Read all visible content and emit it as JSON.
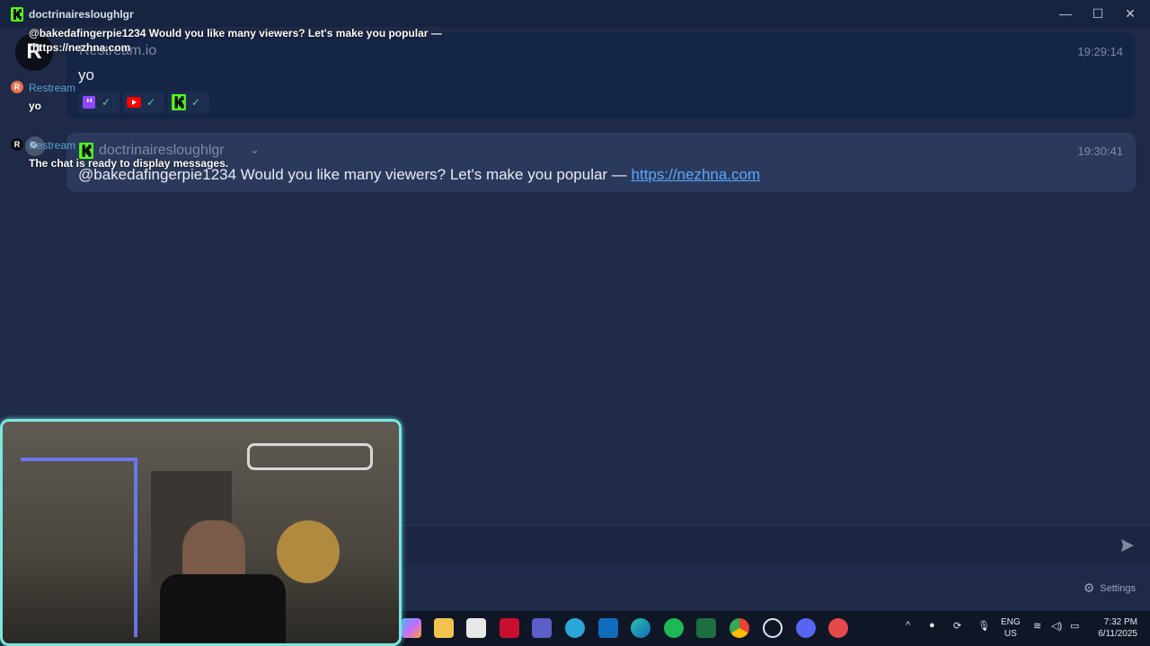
{
  "window": {
    "title": "doctrinairesloughlgr",
    "minimize": "—",
    "maximize": "☐",
    "close": "✕"
  },
  "overlay": {
    "top_line": "@bakedafingerpie1234 Would you like many viewers? Let's make you popular —",
    "top_link": "https://nezhna.com",
    "restream_label": "Restream",
    "restream_msg": "yo",
    "restream_label2": "Restream",
    "ready_text": "The chat is ready to display messages."
  },
  "messages": [
    {
      "sender": "Restream.io",
      "time": "19:29:14",
      "text": "yo",
      "platforms": [
        "twitch",
        "youtube",
        "kick"
      ]
    },
    {
      "sender": "doctrinairesloughlgr",
      "time": "19:30:41",
      "text": "@bakedafingerpie1234 Would you like many viewers? Let's make you popular — ",
      "link": "https://nezhna.com"
    }
  ],
  "settings": {
    "label": "Settings"
  },
  "taskbar": {
    "lang_top": "ENG",
    "lang_bottom": "US",
    "time": "7:32 PM",
    "date": "6/11/2025"
  },
  "colors": {
    "background": "#1e2a47",
    "kick_green": "#53fc18",
    "twitch_purple": "#9146ff",
    "youtube_red": "#ff0000",
    "link": "#5aa9ff"
  }
}
